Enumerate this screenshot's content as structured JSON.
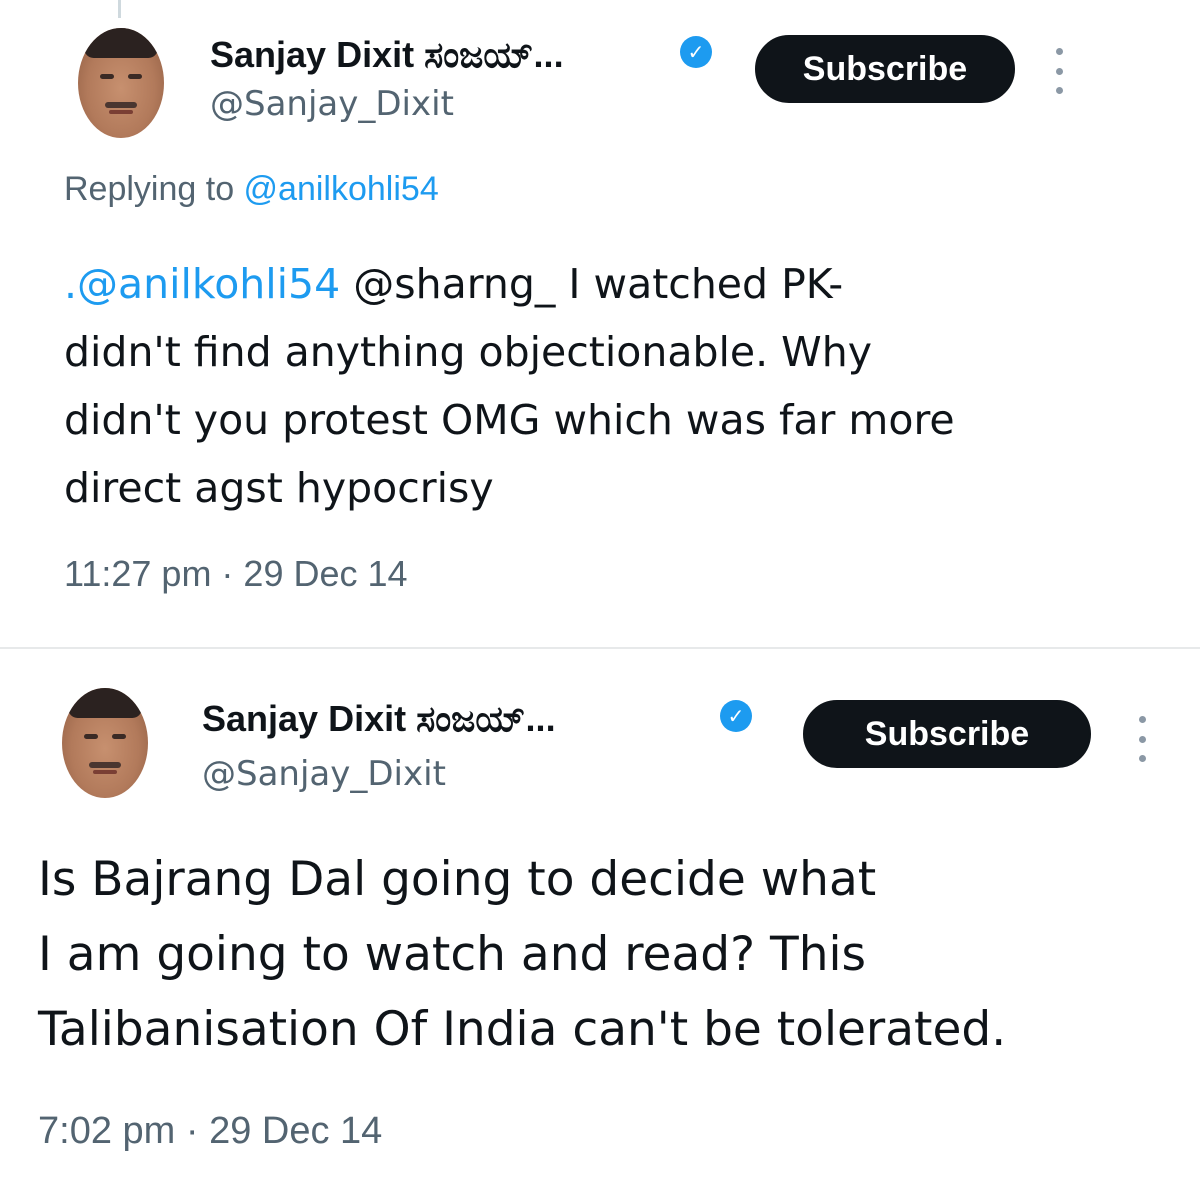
{
  "colors": {
    "link": "#1d9bf0",
    "text": "#0f1419",
    "secondary": "#536471",
    "subscribe_bg": "#0f1419",
    "verified": "#1d9bf0"
  },
  "tweets": [
    {
      "author_name": "Sanjay Dixit ಸಂಜಯ್...",
      "handle": "@Sanjay_Dixit",
      "subscribe_label": "Subscribe",
      "verified_icon": "✓",
      "replying_prefix": "Replying to ",
      "replying_to": "@anilkohli54",
      "body": {
        "mention1": ".@anilkohli54",
        "line1_rest": " @sharng_ I watched PK-",
        "line2": "didn't find anything objectionable. Why",
        "line3": "didn't you protest OMG which was far more",
        "line4": "direct agst hypocrisy"
      },
      "timestamp": "11:27 pm · 29 Dec 14"
    },
    {
      "author_name": "Sanjay Dixit ಸಂಜಯ್...",
      "handle": "@Sanjay_Dixit",
      "subscribe_label": "Subscribe",
      "verified_icon": "✓",
      "body": {
        "line1": "Is Bajrang Dal going to decide what",
        "line2": "I am going to watch and read? This",
        "line3": "Talibanisation Of India can't be tolerated."
      },
      "timestamp": "7:02 pm · 29 Dec 14"
    }
  ]
}
